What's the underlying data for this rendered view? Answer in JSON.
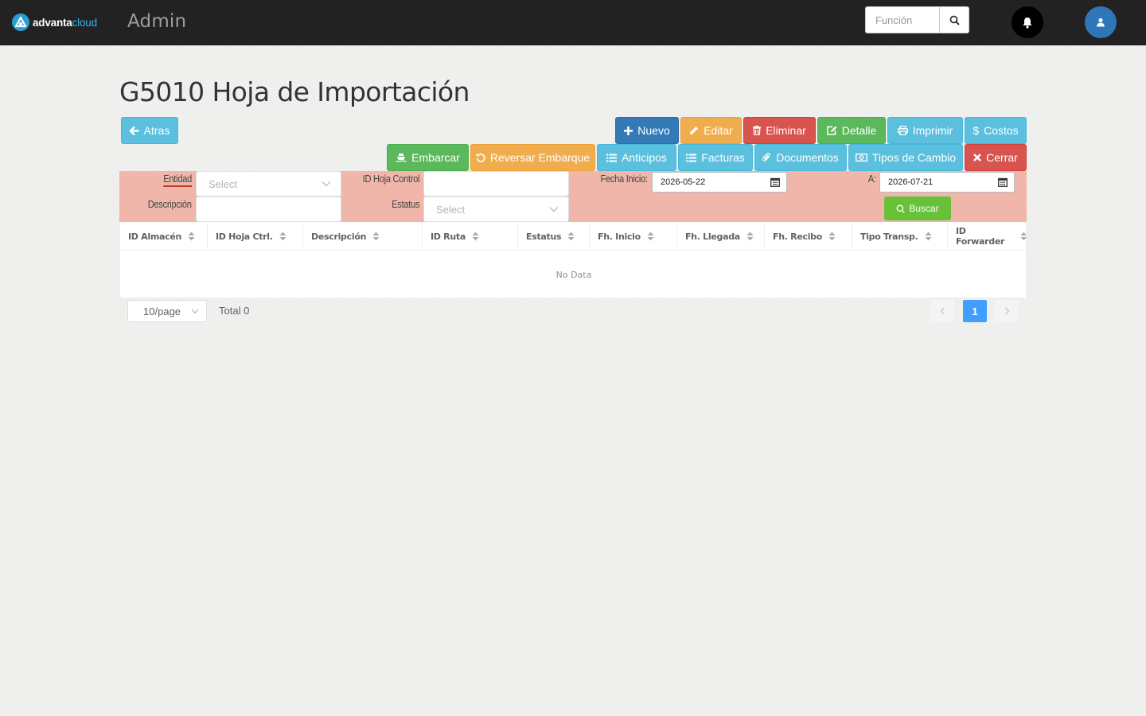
{
  "navbar": {
    "logo_part1": "advanta",
    "logo_part2": "cloud",
    "title": "Admin",
    "search_placeholder": "Función"
  },
  "page": {
    "title": "G5010 Hoja de Importación"
  },
  "buttons": {
    "back": "Atras",
    "nuevo": "Nuevo",
    "editar": "Editar",
    "eliminar": "Eliminar",
    "detalle": "Detalle",
    "imprimir": "Imprimir",
    "costos": "Costos",
    "embarcar": "Embarcar",
    "reversar": "Reversar Embarque",
    "anticipos": "Anticipos",
    "facturas": "Facturas",
    "documentos": "Documentos",
    "tipos_cambio": "Tipos de Cambio",
    "cerrar": "Cerrar"
  },
  "filters": {
    "entidad_label": "Entidad",
    "entidad_placeholder": "Select",
    "descripcion_label": "Descripción",
    "descripcion_value": "",
    "id_hoja_label": "ID Hoja Control",
    "id_hoja_value": "",
    "estatus_label": "Estatus",
    "estatus_placeholder": "Select",
    "fecha_inicio_label": "Fecha Inicio:",
    "fecha_inicio_value": "2026-05-22",
    "fecha_fin_label": "A:",
    "fecha_fin_value": "2026-07-21",
    "buscar": "Buscar"
  },
  "table": {
    "columns": [
      "ID Almacén",
      "ID Hoja Ctrl.",
      "Descripción",
      "ID Ruta",
      "Estatus",
      "Fh. Inicio",
      "Fh. Llegada",
      "Fh. Recibo",
      "Tipo Transp.",
      "ID Forwarder"
    ],
    "empty_text": "No Data"
  },
  "pagination": {
    "page_size": "10/page",
    "total": "Total 0",
    "current_page": "1"
  },
  "colors": {
    "navbar": "#222222",
    "filter_panel": "#efb6a9",
    "info": "#5bc0de",
    "primary": "#337ab7",
    "warning": "#f0ad4e",
    "danger": "#d9534f",
    "success": "#5cb85c",
    "pagination_active": "#409eff"
  }
}
